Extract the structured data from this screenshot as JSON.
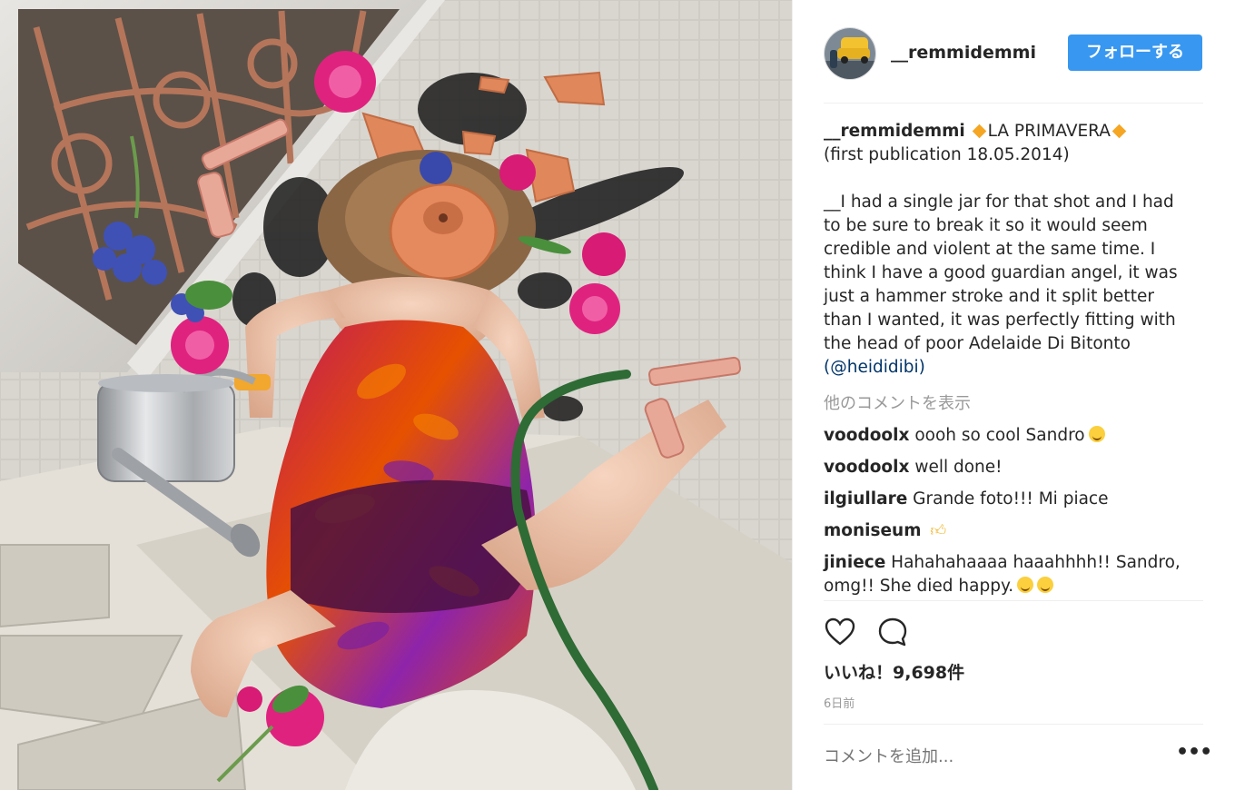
{
  "post": {
    "username": "__remmidemmi",
    "follow_label": "フォローする",
    "caption": {
      "username": "__remmidemmi",
      "title": "LA PRIMAVERA",
      "line2": "(first publication 18.05.2014)",
      "body": "__I had a single jar for that shot and I had to be sure to break it so it would seem credible and violent at the same time. I think I have a good guardian angel, it was just a hammer stroke and it split better than I wanted, it was perfectly fitting with the head of poor Adelaide Di Bitonto",
      "mention": "(@heididibi)"
    },
    "more_comments_label": "他のコメントを表示",
    "comments": [
      {
        "user": "voodoolx",
        "text": "oooh so cool Sandro"
      },
      {
        "user": "voodoolx",
        "text": "well done!"
      },
      {
        "user": "ilgiullare",
        "text": "Grande foto!!! Mi piace"
      },
      {
        "user": "moniseum",
        "text": ""
      },
      {
        "user": "jiniece",
        "text": "Hahahahaaaa haaahhhh!! Sandro, omg!! She died happy."
      }
    ],
    "likes": "いいね！9,698件",
    "time": "6日前",
    "add_comment_placeholder": "コメントを追加...",
    "more_options": "•••"
  },
  "icons": {
    "like": "heart-icon",
    "comment": "speech-bubble-icon",
    "more": "ellipsis-icon",
    "caption_marker": "orange-diamond-icon"
  },
  "colors": {
    "follow_button": "#3897f0",
    "mention": "#003569",
    "muted": "#999999",
    "text": "#262626"
  }
}
